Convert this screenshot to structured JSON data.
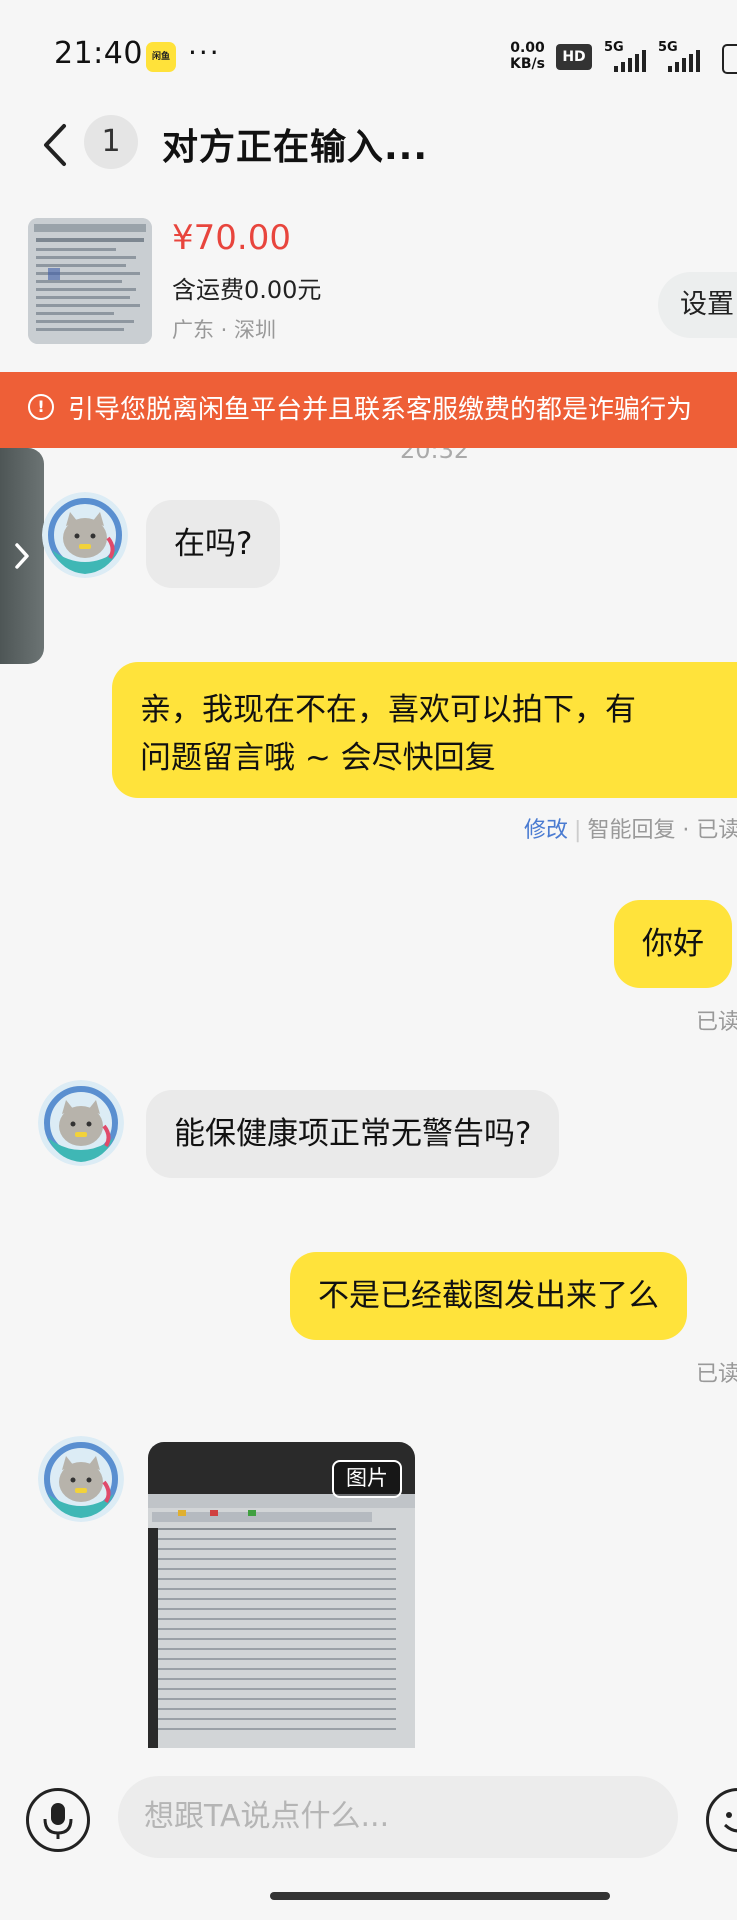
{
  "status_bar": {
    "time": "21:40",
    "app_badge": "闲鱼",
    "dots": "···",
    "net_speed_value": "0.00",
    "net_speed_unit": "KB/s",
    "hd": "HD",
    "signal1_label": "5G",
    "signal2_label": "5G"
  },
  "header": {
    "unread_count": "1",
    "title": "对方正在输入..."
  },
  "product": {
    "price": "¥70.00",
    "shipping": "含运费0.00元",
    "location": "广东 · 深圳",
    "settings_label": "设置"
  },
  "warning": {
    "text": "引导您脱离闲鱼平台并且联系客服缴费的都是诈骗行为"
  },
  "timestamp": "20:32",
  "messages": [
    {
      "side": "in",
      "text": "在吗?"
    },
    {
      "side": "out",
      "text_line1": "亲，我现在不在，喜欢可以拍下，有",
      "text_line2": "问题留言哦 ~ 会尽快回复",
      "meta_link": "修改",
      "meta_rest": "智能回复 · 已读"
    },
    {
      "side": "out",
      "text": "你好",
      "meta": "已读"
    },
    {
      "side": "in",
      "text": "能保健康项正常无警告吗?"
    },
    {
      "side": "out",
      "text": "不是已经截图发出来了么",
      "meta": "已读"
    },
    {
      "side": "in",
      "type": "image",
      "badge": "图片"
    }
  ],
  "input": {
    "placeholder": "想跟TA说点什么..."
  },
  "colors": {
    "accent_yellow": "#ffe33b",
    "price_red": "#e8453d",
    "warning_orange": "#ee5f37"
  }
}
